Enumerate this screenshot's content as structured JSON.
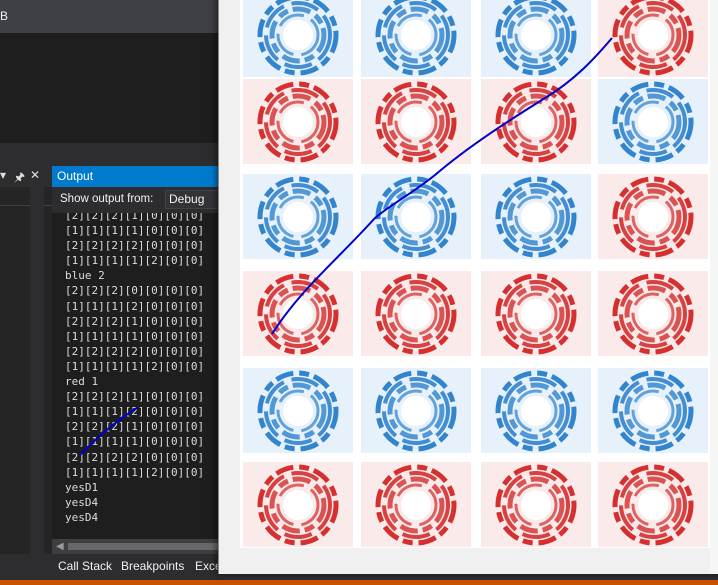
{
  "ide": {
    "title_fragment": "B",
    "left_panel_icons": [
      "▾",
      "🖈",
      "✕"
    ],
    "output_panel": {
      "title": "Output",
      "show_output_from_label": "Show output from:",
      "source_value": "Debug",
      "lines": [
        "[2][2][2][1][0][0][0]",
        "[1][1][1][1][0][0][0]",
        "[2][2][2][2][0][0][0]",
        "[1][1][1][1][2][0][0]",
        "blue 2",
        "[2][2][2][0][0][0][0]",
        "[1][1][1][2][0][0][0]",
        "[2][2][2][1][0][0][0]",
        "[1][1][1][1][0][0][0]",
        "[2][2][2][2][0][0][0]",
        "[1][1][1][1][2][0][0]",
        "red 1",
        "[2][2][2][1][0][0][0]",
        "[1][1][1][2][0][0][0]",
        "[2][2][2][1][0][0][0]",
        "[1][1][1][1][0][0][0]",
        "[2][2][2][2][0][0][0]",
        "[1][1][1][1][2][0][0]",
        "yesD1",
        "yesD4",
        "yesD4"
      ]
    },
    "bottom_tabs": [
      "Call Stack",
      "Breakpoints",
      "Exce"
    ],
    "colors": {
      "accent": "#007acc",
      "status": "#ca5100"
    }
  },
  "game_board": {
    "grid": [
      [
        "blue",
        "blue",
        "blue",
        "red"
      ],
      [
        "red",
        "red",
        "red",
        "blue"
      ],
      [
        "blue",
        "blue",
        "blue",
        "red"
      ],
      [
        "red",
        "red",
        "red",
        "red"
      ],
      [
        "blue",
        "blue",
        "blue",
        "blue"
      ],
      [
        "red",
        "red",
        "red",
        "red"
      ]
    ],
    "tile_colors": {
      "red": "#d01c1c",
      "blue": "#1e78c8"
    },
    "line_color": "#0000cc"
  }
}
